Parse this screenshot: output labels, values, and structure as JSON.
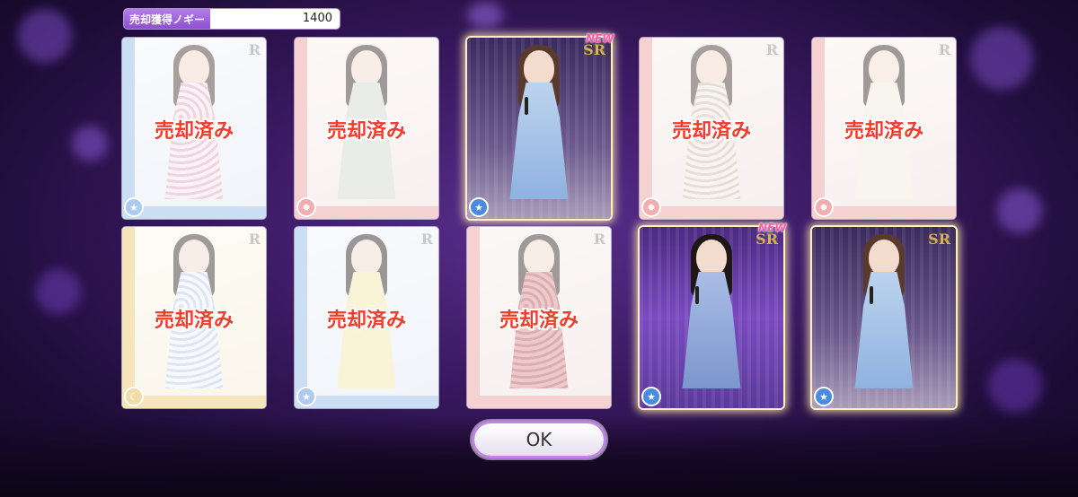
{
  "header": {
    "nogi_label": "売却獲得ノギー",
    "nogi_value": "1400"
  },
  "colors": {
    "accent": "#a56ae0",
    "sold_text": "#f23b2a",
    "new_badge": "#ff5aa5"
  },
  "cards": [
    {
      "id": "c1",
      "status": "sold",
      "sold_label": "売却済み",
      "rarity": "R",
      "frame": "blue",
      "type_icon": "star-icon"
    },
    {
      "id": "c2",
      "status": "sold",
      "sold_label": "売却済み",
      "rarity": "",
      "frame": "red",
      "type_icon": "sun-icon"
    },
    {
      "id": "c3",
      "status": "kept",
      "sold_label": "",
      "rarity": "SR",
      "frame": "gold",
      "type_icon": "star-icon",
      "new": "NEW"
    },
    {
      "id": "c4",
      "status": "sold",
      "sold_label": "売却済み",
      "rarity": "R",
      "frame": "red",
      "type_icon": "sun-icon"
    },
    {
      "id": "c5",
      "status": "sold",
      "sold_label": "売却済み",
      "rarity": "R",
      "frame": "red",
      "type_icon": "sun-icon"
    },
    {
      "id": "c6",
      "status": "sold",
      "sold_label": "売却済み",
      "rarity": "R",
      "frame": "yellow",
      "type_icon": "moon-icon"
    },
    {
      "id": "c7",
      "status": "sold",
      "sold_label": "売却済み",
      "rarity": "R",
      "frame": "blue",
      "type_icon": "star-icon"
    },
    {
      "id": "c8",
      "status": "sold",
      "sold_label": "売却済み",
      "rarity": "R",
      "frame": "red",
      "type_icon": ""
    },
    {
      "id": "c9",
      "status": "kept",
      "sold_label": "",
      "rarity": "SR",
      "frame": "gold",
      "type_icon": "star-icon",
      "new": "NEW"
    },
    {
      "id": "c10",
      "status": "kept",
      "sold_label": "",
      "rarity": "SR",
      "frame": "gold",
      "type_icon": "star-icon"
    }
  ],
  "ok_button": {
    "label": "OK"
  }
}
